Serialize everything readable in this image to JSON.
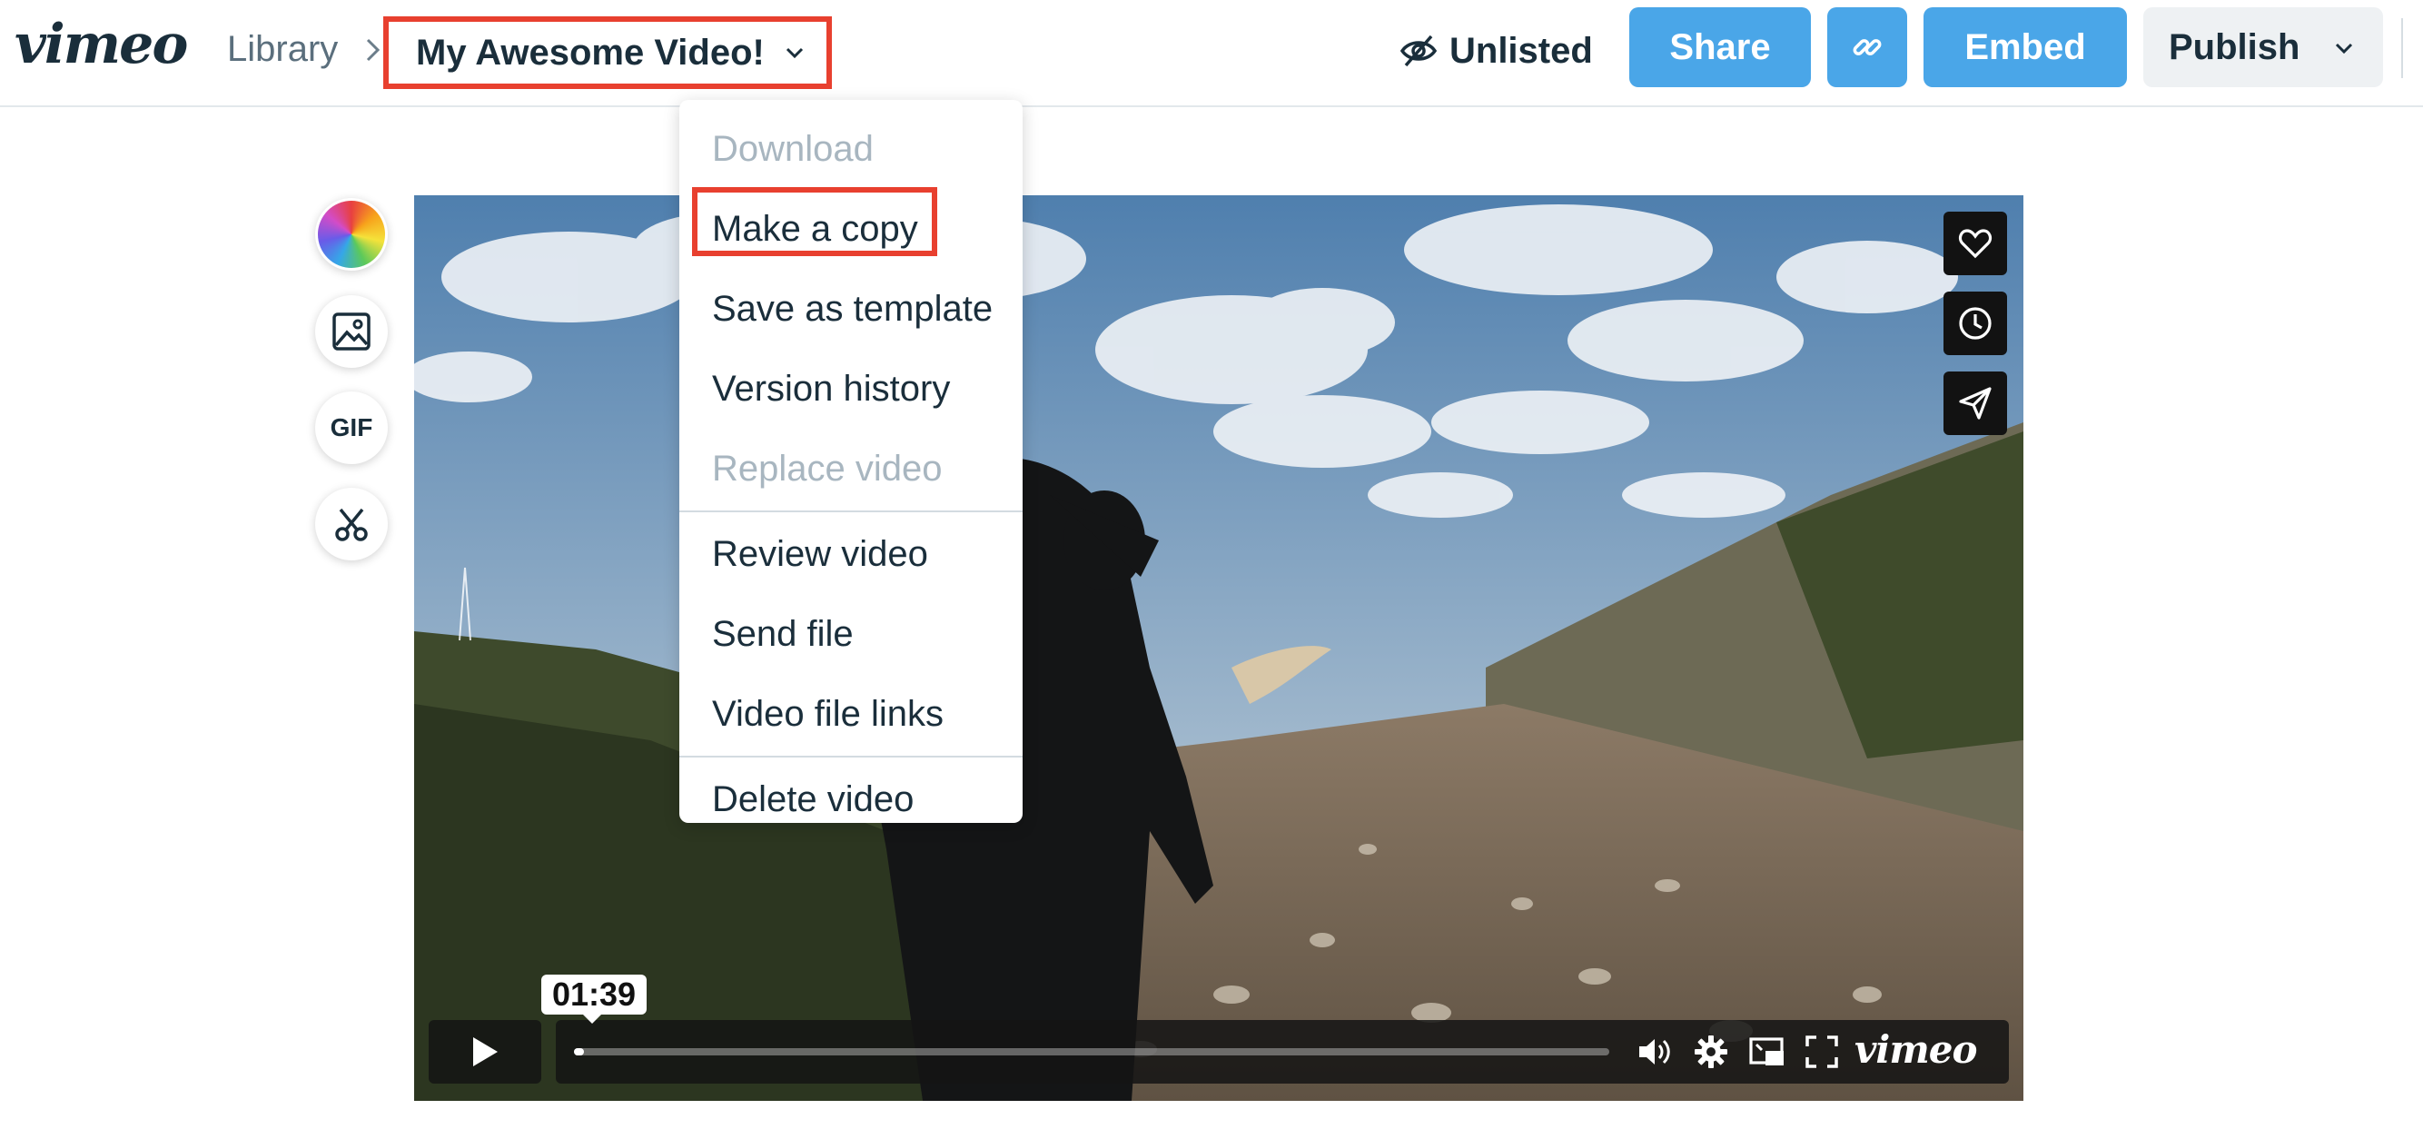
{
  "header": {
    "logo": "vimeo",
    "breadcrumb": {
      "library": "Library"
    },
    "video_title": "My Awesome Video!",
    "privacy_label": "Unlisted",
    "share_label": "Share",
    "embed_label": "Embed",
    "publish_label": "Publish"
  },
  "tools": {
    "gif_label": "GIF"
  },
  "player": {
    "current_time": "01:39",
    "progress": 0.01,
    "logo": "vimeo"
  },
  "menu": {
    "items": [
      {
        "label": "Download",
        "disabled": true
      },
      {
        "label": "Make a copy",
        "disabled": false
      },
      {
        "label": "Save as template",
        "disabled": false
      },
      {
        "label": "Version history",
        "disabled": false
      },
      {
        "label": "Replace video",
        "disabled": true
      },
      {
        "label": "Review video",
        "disabled": false
      },
      {
        "label": "Send file",
        "disabled": false
      },
      {
        "label": "Video file links",
        "disabled": false
      },
      {
        "label": "Delete video",
        "disabled": false
      }
    ]
  },
  "colors": {
    "accent_blue": "#4aa6e8",
    "highlight_red": "#e8402f",
    "text_dark": "#1a2e3b",
    "text_disabled": "#a8b6c0"
  },
  "icons": {
    "privacy": "eye-slash-icon",
    "link": "link-icon",
    "like": "heart-icon",
    "watch_later": "clock-icon",
    "share": "paper-plane-icon",
    "play": "play-icon",
    "volume": "volume-icon",
    "settings": "gear-icon",
    "pip": "picture-in-picture-icon",
    "fullscreen": "fullscreen-icon",
    "image": "image-icon",
    "trim": "scissors-icon"
  }
}
